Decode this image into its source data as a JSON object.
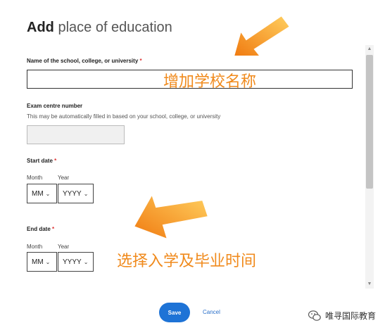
{
  "dialog": {
    "title_bold": "Add",
    "title_rest": "place of education"
  },
  "school": {
    "label": "Name of the school, college, or university",
    "required_mark": "*",
    "value": ""
  },
  "exam": {
    "label": "Exam centre number",
    "hint": "This may be automatically filled in based on your school, college, or university",
    "value": ""
  },
  "start_date": {
    "label": "Start date",
    "required_mark": "*",
    "month_label": "Month",
    "year_label": "Year",
    "month_value": "MM",
    "year_value": "YYYY"
  },
  "end_date": {
    "label": "End date",
    "required_mark": "*",
    "month_label": "Month",
    "year_label": "Year",
    "month_value": "MM",
    "year_value": "YYYY"
  },
  "footer": {
    "save_label": "Save",
    "cancel_label": "Cancel"
  },
  "annotations": {
    "school_note": "增加学校名称",
    "date_note": "选择入学及毕业时间",
    "color": "#f08a1c"
  },
  "watermark": {
    "text": "唯寻国际教育",
    "icon": "wechat-logo-icon"
  },
  "colors": {
    "primary": "#1e73d6",
    "required": "#d33333"
  }
}
